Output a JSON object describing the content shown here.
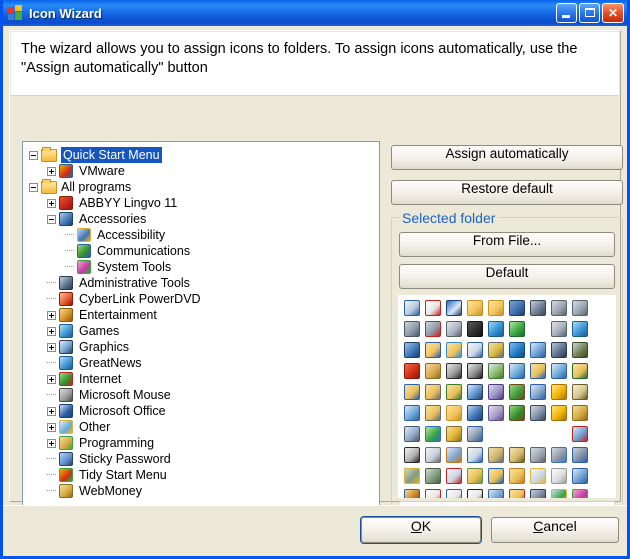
{
  "window": {
    "title": "Icon Wizard",
    "title_icon": "windows-squares-icon",
    "minimize_label": "Minimize",
    "maximize_label": "Maximize",
    "close_label": "Close"
  },
  "instructions": {
    "text": "The wizard allows you to assign icons to folders. To assign icons automatically, use the \"Assign automatically\" button"
  },
  "tree": {
    "items": [
      {
        "label": "Quick Start Menu",
        "indent": 0,
        "toggle": "minus",
        "icon": "folder-open-icon",
        "selected": true
      },
      {
        "label": "VMware",
        "indent": 1,
        "toggle": "plus",
        "icon": "vmware-icon",
        "selected": false
      },
      {
        "label": "All programs",
        "indent": 0,
        "toggle": "minus",
        "icon": "folder-open-icon",
        "selected": false
      },
      {
        "label": "ABBYY Lingvo 11",
        "indent": 1,
        "toggle": "plus",
        "icon": "abbyy-book-icon",
        "selected": false
      },
      {
        "label": "Accessories",
        "indent": 1,
        "toggle": "minus",
        "icon": "accessories-icon",
        "selected": false
      },
      {
        "label": "Accessibility",
        "indent": 2,
        "toggle": "none",
        "icon": "accessibility-icon",
        "selected": false
      },
      {
        "label": "Communications",
        "indent": 2,
        "toggle": "none",
        "icon": "communications-globe-icon",
        "selected": false
      },
      {
        "label": "System Tools",
        "indent": 2,
        "toggle": "none",
        "icon": "system-tools-icon",
        "selected": false
      },
      {
        "label": "Administrative Tools",
        "indent": 1,
        "toggle": "none",
        "icon": "computer-monitor-icon",
        "selected": false
      },
      {
        "label": "CyberLink PowerDVD",
        "indent": 1,
        "toggle": "none",
        "icon": "powerdvd-icon",
        "selected": false
      },
      {
        "label": "Entertainment",
        "indent": 1,
        "toggle": "plus",
        "icon": "entertainment-icon",
        "selected": false
      },
      {
        "label": "Games",
        "indent": 1,
        "toggle": "plus",
        "icon": "games-icon",
        "selected": false
      },
      {
        "label": "Graphics",
        "indent": 1,
        "toggle": "plus",
        "icon": "graphics-pencil-icon",
        "selected": false
      },
      {
        "label": "GreatNews",
        "indent": 1,
        "toggle": "none",
        "icon": "greatnews-icon",
        "selected": false
      },
      {
        "label": "Internet",
        "indent": 1,
        "toggle": "plus",
        "icon": "internet-icon",
        "selected": false
      },
      {
        "label": "Microsoft Mouse",
        "indent": 1,
        "toggle": "none",
        "icon": "mouse-cursor-icon",
        "selected": false
      },
      {
        "label": "Microsoft Office",
        "indent": 1,
        "toggle": "plus",
        "icon": "word-w-icon",
        "selected": false
      },
      {
        "label": "Other",
        "indent": 1,
        "toggle": "plus",
        "icon": "other-folder-icon",
        "selected": false
      },
      {
        "label": "Programming",
        "indent": 1,
        "toggle": "plus",
        "icon": "programming-key-icon",
        "selected": false
      },
      {
        "label": "Sticky Password",
        "indent": 1,
        "toggle": "none",
        "icon": "sticky-password-icon",
        "selected": false
      },
      {
        "label": "Tidy Start Menu",
        "indent": 1,
        "toggle": "none",
        "icon": "tidy-start-menu-icon",
        "selected": false
      },
      {
        "label": "WebMoney",
        "indent": 1,
        "toggle": "none",
        "icon": "webmoney-key-icon",
        "selected": false
      }
    ]
  },
  "right_panel": {
    "assign_label": "Assign automatically",
    "restore_label": "Restore default",
    "group_legend": "Selected folder",
    "from_file_label": "From File...",
    "default_label": "Default",
    "scroll_down_label": "scroll-down-arrow"
  },
  "icon_grid": {
    "columns": 9,
    "cells": [
      {
        "n": "document-window-icon",
        "c1": "#f5f5f5",
        "c2": "#b9c9dd",
        "c3": "#2b5fa8"
      },
      {
        "n": "audio-file-icon",
        "c1": "#fdfdfd",
        "c2": "#e6e6e6",
        "c3": "#c4221d"
      },
      {
        "n": "window-blue-icon",
        "c1": "#2a6fc4",
        "c2": "#dce8f5",
        "c3": "#16427a"
      },
      {
        "n": "folder-closed-icon",
        "c1": "#fde3a0",
        "c2": "#f3c35c",
        "c3": "#c59320"
      },
      {
        "n": "folder-open-icon",
        "c1": "#fde3a0",
        "c2": "#f3c35c",
        "c3": "#c59320"
      },
      {
        "n": "network-connection-icon",
        "c1": "#7fa4cc",
        "c2": "#3b6fae",
        "c3": "#1d3f6b"
      },
      {
        "n": "floppy-drive-icon",
        "c1": "#c3ccd8",
        "c2": "#6f7f95",
        "c3": "#3a4757"
      },
      {
        "n": "printer-gray-icon",
        "c1": "#d6dbe0",
        "c2": "#9aa5b0",
        "c3": "#5a636d"
      },
      {
        "n": "printer-network-icon",
        "c1": "#d6dbe0",
        "c2": "#9aa5b0",
        "c3": "#5a636d"
      },
      {
        "n": "network-share-icon",
        "c1": "#cfd6de",
        "c2": "#8d99a8",
        "c3": "#4c5764"
      },
      {
        "n": "network-disconnect-icon",
        "c1": "#cfd6de",
        "c2": "#8d99a8",
        "c3": "#c4221d"
      },
      {
        "n": "cd-drive-icon",
        "c1": "#e3e7ec",
        "c2": "#aab4c0",
        "c3": "#5a636d"
      },
      {
        "n": "chip-icon",
        "c1": "#5a5a5a",
        "c2": "#2e2e2e",
        "c3": "#111111"
      },
      {
        "n": "globe-internet-icon",
        "c1": "#9fd8ef",
        "c2": "#2f8fd4",
        "c3": "#1b5d90"
      },
      {
        "n": "globe-green-icon",
        "c1": "#b6e6a4",
        "c2": "#3aa43f",
        "c3": "#1f6b28"
      },
      {
        "n": "server-computer-icon",
        "c1": "#c9d4e2",
        "c2": "#7f8fa6",
        "c3": "#47soft"
      },
      {
        "n": "printer-fax-icon",
        "c1": "#dfe4e9",
        "c2": "#a4aeb9",
        "c3": "#5a636d"
      },
      {
        "n": "network-globe-icon",
        "c1": "#a9ddf3",
        "c2": "#3a93d6",
        "c3": "#1d5d90"
      },
      {
        "n": "network-tree-icon",
        "c1": "#9fc2e8",
        "c2": "#3d76b8",
        "c3": "#1d3f6b"
      },
      {
        "n": "folder-shared-icon",
        "c1": "#fde3a0",
        "c2": "#f3c35c",
        "c3": "#2b5fa8"
      },
      {
        "n": "folder-recent-icon",
        "c1": "#fde3a0",
        "c2": "#f3c35c",
        "c3": "#2f8fd4"
      },
      {
        "n": "edit-document-icon",
        "c1": "#f5f5f5",
        "c2": "#ccd6e4",
        "c3": "#2b5fa8"
      },
      {
        "n": "search-magnifier-icon",
        "c1": "#f0e7a8",
        "c2": "#d6b63c",
        "c3": "#6b6b6b"
      },
      {
        "n": "help-question-icon",
        "c1": "#7fc0ee",
        "c2": "#1f79c6",
        "c3": "#0f4b86"
      },
      {
        "n": "window-list-icon",
        "c1": "#dbe7f5",
        "c2": "#6f9fd0",
        "c3": "#2b5fa8"
      },
      {
        "n": "media-window-icon",
        "c1": "#b9c4d4",
        "c2": "#5a6f8c",
        "c3": "#2b3a4d"
      },
      {
        "n": "box-package-icon",
        "c1": "#cfd6de",
        "c2": "#6f8050",
        "c3": "#3c4a2a"
      },
      {
        "n": "shutdown-power-icon",
        "c1": "#f26a4f",
        "c2": "#d42d12",
        "c3": "#8c1a06"
      },
      {
        "n": "hand-pointer-icon",
        "c1": "#f3d9a8",
        "c2": "#d9a84c",
        "c3": "#8c6a20"
      },
      {
        "n": "shortcut-arrow-icon",
        "c1": "#e9e9e9",
        "c2": "#9a9a9a",
        "c3": "#2b2b2b"
      },
      {
        "n": "small-symbol-icon",
        "c1": "#e9e9e9",
        "c2": "#8c8c8c",
        "c3": "#1f1f1f"
      },
      {
        "n": "folder-refresh-icon",
        "c1": "#dfeaf7",
        "c2": "#8ab86a",
        "c3": "#3c7a2a"
      },
      {
        "n": "folder-sync-icon",
        "c1": "#dfeaf7",
        "c2": "#6aa8d8",
        "c3": "#2b5fa8"
      },
      {
        "n": "folder-edit-icon",
        "c1": "#fde3a0",
        "c2": "#e8c05a",
        "c3": "#2b5fa8"
      },
      {
        "n": "folder-clock-icon",
        "c1": "#dfeaf7",
        "c2": "#6aa8d8",
        "c3": "#2b5fa8"
      },
      {
        "n": "folder-key-icon",
        "c1": "#fde3a0",
        "c2": "#e8c05a",
        "c3": "#1f6b28"
      },
      {
        "n": "folder-window-icon",
        "c1": "#fde3a0",
        "c2": "#e8c05a",
        "c3": "#2b5fa8"
      },
      {
        "n": "folder-gear-icon",
        "c1": "#fde3a0",
        "c2": "#e8c05a",
        "c3": "#6b6b6b"
      },
      {
        "n": "folder-open-green-icon",
        "c1": "#fde3a0",
        "c2": "#e8c05a",
        "c3": "#3c7a2a"
      },
      {
        "n": "folder-computer-icon",
        "c1": "#dfeaf7",
        "c2": "#5a8fd0",
        "c3": "#2b3f6b"
      },
      {
        "n": "cd-media-icon",
        "c1": "#e0dcf0",
        "c2": "#9a8fc4",
        "c3": "#4a3f7a"
      },
      {
        "n": "tree-nature-icon",
        "c1": "#9ed67f",
        "c2": "#3c9a3a",
        "c3": "#6b4a1f"
      },
      {
        "n": "folder-scanner-icon",
        "c1": "#dfeaf7",
        "c2": "#7fa4cc",
        "c3": "#2b5fa8"
      },
      {
        "n": "star-favorites-icon",
        "c1": "#ffe680",
        "c2": "#f0b400",
        "c3": "#a87000"
      },
      {
        "n": "pencil-edit-icon",
        "c1": "#f5f0dc",
        "c2": "#d6c48c",
        "c3": "#6b5a2a"
      },
      {
        "n": "folder-picture-icon",
        "c1": "#dfeaf7",
        "c2": "#6aa8d8",
        "c3": "#2b5fa8"
      },
      {
        "n": "folder-settings-icon",
        "c1": "#fde3a0",
        "c2": "#e8c05a",
        "c3": "#6b6b6b"
      },
      {
        "n": "folder-open-yellow-icon",
        "c1": "#fde3a0",
        "c2": "#f3c35c",
        "c3": "#c59320"
      },
      {
        "n": "database-blue-icon",
        "c1": "#bfd4ee",
        "c2": "#3d76b8",
        "c3": "#1d3f6b"
      },
      {
        "n": "cd-disc-icon",
        "c1": "#e3e0f0",
        "c2": "#a89ac9",
        "c3": "#5a4f86"
      },
      {
        "n": "tree-green-icon",
        "c1": "#9ed67f",
        "c2": "#2f8f2f",
        "c3": "#6b4a1f"
      },
      {
        "n": "scanner-device-icon",
        "c1": "#d6dbe0",
        "c2": "#7f8fa6",
        "c3": "#3a4757"
      },
      {
        "n": "star-gold-icon",
        "c1": "#ffe680",
        "c2": "#f0b400",
        "c3": "#a87000"
      },
      {
        "n": "key-gold-icon",
        "c1": "#f5e2a0",
        "c2": "#d6a83c",
        "c3": "#8c6a20"
      },
      {
        "n": "search-folder-icon",
        "c1": "#dfeaf7",
        "c2": "#8fa8c4",
        "c3": "#4a5a6b"
      },
      {
        "n": "globe-color-icon",
        "c1": "#b6e6a4",
        "c2": "#3aa43f",
        "c3": "#2f6fc4"
      },
      {
        "n": "lock-secure-icon",
        "c1": "#f5e2a0",
        "c2": "#e0b233",
        "c3": "#8c6a20"
      },
      {
        "n": "media-player-icon",
        "c1": "#dfe4ec",
        "c2": "#8c9ab0",
        "c3": "#2b5fa8"
      },
      {
        "n": "empty-cell",
        "c1": "",
        "c2": "",
        "c3": ""
      },
      {
        "n": "empty-cell",
        "c1": "",
        "c2": "",
        "c3": ""
      },
      {
        "n": "empty-cell",
        "c1": "",
        "c2": "",
        "c3": ""
      },
      {
        "n": "empty-cell",
        "c1": "",
        "c2": "",
        "c3": ""
      },
      {
        "n": "window-error-icon",
        "c1": "#dbe7f5",
        "c2": "#6f9fd0",
        "c3": "#c4221d"
      },
      {
        "n": "arrow-corner-icon",
        "c1": "#f5f5f5",
        "c2": "#b0b0b0",
        "c3": "#2b2b2b"
      },
      {
        "n": "document-search-icon",
        "c1": "#f5f5f5",
        "c2": "#c4d0de",
        "c3": "#6b6b6b"
      },
      {
        "n": "search-color-icon",
        "c1": "#dfeaf7",
        "c2": "#7fa4cc",
        "c3": "#c47a1f"
      },
      {
        "n": "document-check-icon",
        "c1": "#f5f5f5",
        "c2": "#ccd6e4",
        "c3": "#2b5fa8"
      },
      {
        "n": "printer-yellow-icon",
        "c1": "#f5e2a0",
        "c2": "#cbb46c",
        "c3": "#6b6b6b"
      },
      {
        "n": "image-frame-icon",
        "c1": "#f5e6b8",
        "c2": "#d6b86c",
        "c3": "#6b5a2a"
      },
      {
        "n": "printer-device-icon",
        "c1": "#d6dbe0",
        "c2": "#9aa5b0",
        "c3": "#5a636d"
      },
      {
        "n": "printer-floppy-icon",
        "c1": "#d6dbe0",
        "c2": "#8d99a8",
        "c3": "#3d76b8"
      },
      {
        "n": "printer-network-blue-icon",
        "c1": "#cfd6de",
        "c2": "#7f8fa6",
        "c3": "#2b5fa8"
      },
      {
        "n": "recycle-full-icon",
        "c1": "#cfd9cf",
        "c2": "#7f9a7f",
        "c3": "#e0b233"
      },
      {
        "n": "recycle-empty-icon",
        "c1": "#cfd9cf",
        "c2": "#7f9a7f",
        "c3": "#4a5f4a"
      },
      {
        "n": "document-delete-icon",
        "c1": "#f5f5f5",
        "c2": "#ccd6e4",
        "c3": "#c4221d"
      },
      {
        "n": "folder-hand-icon",
        "c1": "#fde3a0",
        "c2": "#e8c05a",
        "c3": "#6b8f3c"
      },
      {
        "n": "folder-pen-icon",
        "c1": "#fde3a0",
        "c2": "#e8c05a",
        "c3": "#2b5fa8"
      },
      {
        "n": "folder-gear-yellow-icon",
        "c1": "#fde3a0",
        "c2": "#e8c05a",
        "c3": "#c47a1f"
      },
      {
        "n": "document-star-icon",
        "c1": "#f5f5f5",
        "c2": "#ccd6e4",
        "c3": "#e0b233"
      },
      {
        "n": "document-blank-icon",
        "c1": "#fdfdfd",
        "c2": "#dcdcdc",
        "c3": "#9a9a9a"
      },
      {
        "n": "window-star-icon",
        "c1": "#dbe7f5",
        "c2": "#6f9fd0",
        "c3": "#2b5fa8"
      },
      {
        "n": "palette-paint-icon",
        "c1": "#f5e2a0",
        "c2": "#c47a1f",
        "c3": "#2b5fa8"
      },
      {
        "n": "font-a-red-icon",
        "c1": "#fdfdfd",
        "c2": "#e6e6e6",
        "c3": "#c4221d"
      },
      {
        "n": "font-t-blue-icon",
        "c1": "#fdfdfd",
        "c2": "#e6e6e6",
        "c3": "#2b5fa8"
      },
      {
        "n": "font-a-italic-icon",
        "c1": "#fdfdfd",
        "c2": "#e6e6e6",
        "c3": "#1f1f1f"
      },
      {
        "n": "window-sheet-icon",
        "c1": "#dbe7f5",
        "c2": "#6f9fd0",
        "c3": "#2b5fa8"
      },
      {
        "n": "folder-truck-icon",
        "c1": "#fde3a0",
        "c2": "#e8c05a",
        "c3": "#c4221d"
      },
      {
        "n": "printer-color-icon",
        "c1": "#c9d4e2",
        "c2": "#6f8096",
        "c3": "#2b3f5a"
      },
      {
        "n": "colors-palette-icon",
        "c1": "#bfe0f0",
        "c2": "#3aa43f",
        "c3": "#e0b233"
      },
      {
        "n": "paint-splash-icon",
        "c1": "#f0a8c4",
        "c2": "#c43aa4",
        "c3": "#3aa43f"
      }
    ]
  },
  "footer": {
    "ok_label": "OK",
    "ok_accel": "O",
    "cancel_label": "Cancel",
    "cancel_accel": "C"
  }
}
